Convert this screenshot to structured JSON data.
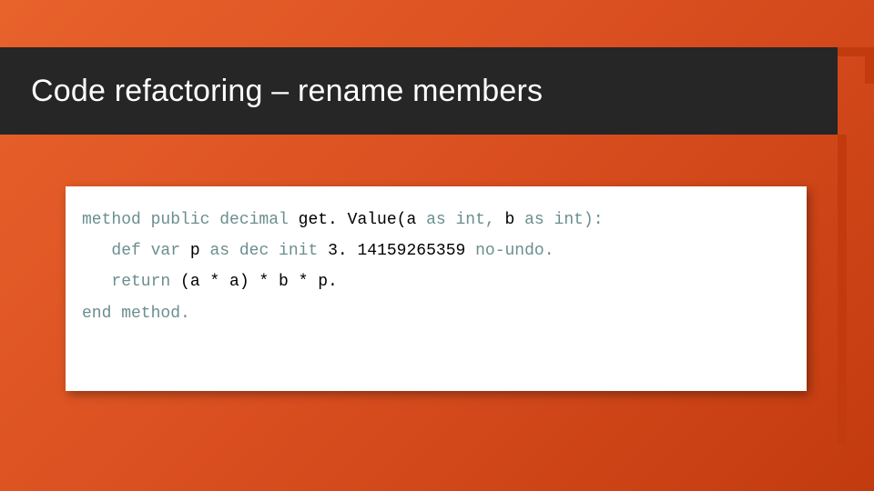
{
  "title": "Code refactoring – rename members",
  "code": {
    "l1_kw1": "method public decimal",
    "l1_rest": " get. Value(a ",
    "l1_kw2": "as int,",
    "l1_mid": " b ",
    "l1_kw3": "as int):",
    "l2_indent": "   ",
    "l2_kw1": "def var",
    "l2_mid1": " p ",
    "l2_kw2": "as dec init",
    "l2_num": " 3. 14159265359 ",
    "l2_kw3": "no-undo.",
    "l3_indent": "   ",
    "l3_kw1": "return",
    "l3_rest": " (a * a) * b * p.",
    "l4_kw1": "end method."
  }
}
